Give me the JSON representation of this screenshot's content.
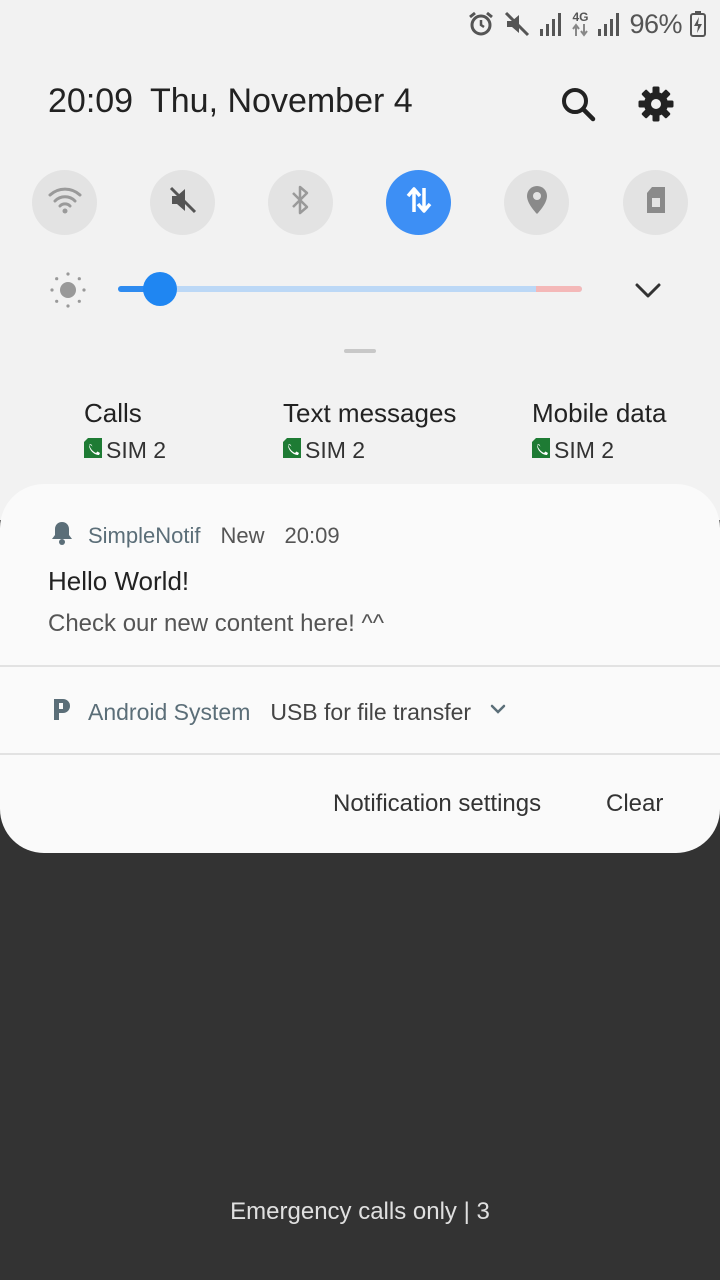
{
  "status_bar": {
    "icons": [
      "alarm-icon",
      "mute-icon",
      "signal-icon",
      "4g-data-icon",
      "signal-icon",
      "battery-charging-icon"
    ],
    "network_type": "4G",
    "battery_percent": "96%"
  },
  "header": {
    "time": "20:09",
    "date": "Thu, November 4",
    "search_icon": "search-icon",
    "settings_icon": "gear-icon"
  },
  "quick_toggles": [
    {
      "name": "wifi",
      "icon": "wifi-icon",
      "active": false
    },
    {
      "name": "sound",
      "icon": "mute-icon",
      "active": false
    },
    {
      "name": "bluetooth",
      "icon": "bluetooth-icon",
      "active": false
    },
    {
      "name": "mobile-data",
      "icon": "data-arrows-icon",
      "active": true
    },
    {
      "name": "location",
      "icon": "location-icon",
      "active": false
    },
    {
      "name": "sim-card",
      "icon": "sim-card-icon",
      "active": false
    }
  ],
  "brightness": {
    "level": 0.09,
    "accent": "#1f86f2"
  },
  "sim_settings": [
    {
      "title": "Calls",
      "sim": "SIM 2"
    },
    {
      "title": "Text messages",
      "sim": "SIM 2"
    },
    {
      "title": "Mobile data",
      "sim": "SIM 2"
    }
  ],
  "notification": {
    "app": "SimpleNotif",
    "badge": "New",
    "time": "20:09",
    "title": "Hello World!",
    "body": "Check our new content here! ^^"
  },
  "system_notification": {
    "app": "Android System",
    "text": "USB for file transfer"
  },
  "actions": {
    "settings_label": "Notification settings",
    "clear_label": "Clear"
  },
  "lockscreen": {
    "carrier_text": "Emergency calls only | 3"
  },
  "colors": {
    "shade_bg": "#f2f2f2",
    "active_toggle": "#3d8ff5",
    "sim_green": "#1e7b34",
    "backdrop": "#333333"
  }
}
